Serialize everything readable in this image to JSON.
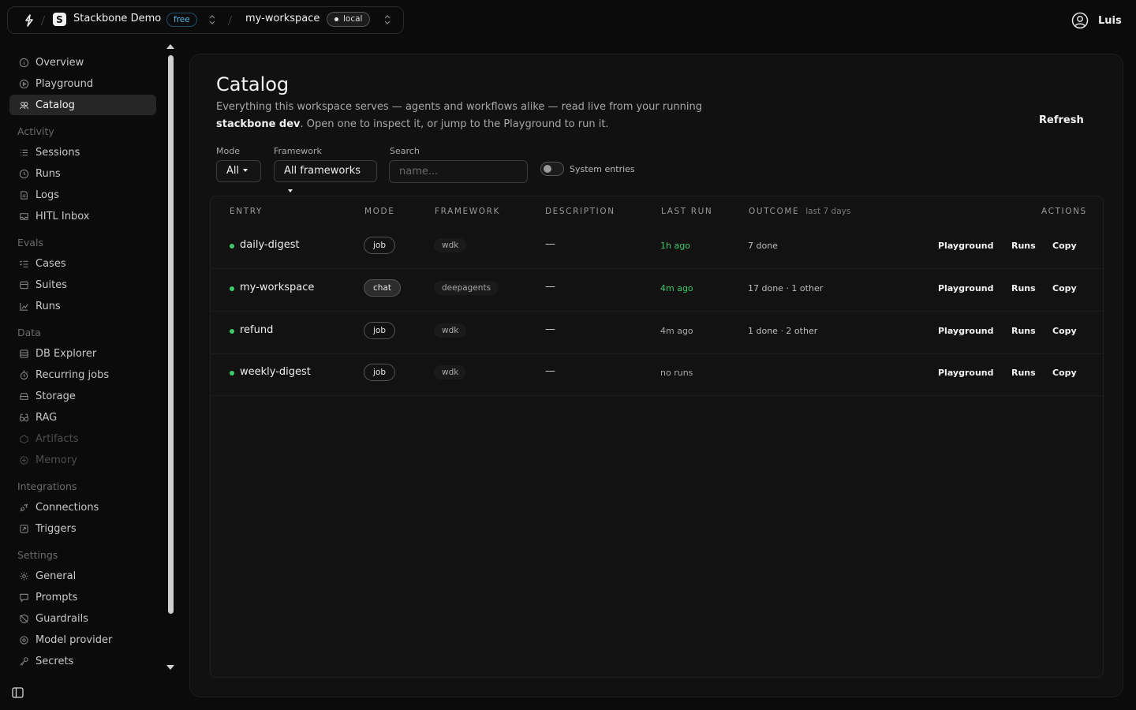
{
  "topbar": {
    "org_initial": "S",
    "org_name": "Stackbone Demo",
    "plan": "free",
    "workspace": "my-workspace",
    "env": "local"
  },
  "user": {
    "name": "Luis"
  },
  "sidebar": {
    "top_items": [
      {
        "label": "Overview",
        "icon": "info-circle-icon"
      },
      {
        "label": "Playground",
        "icon": "play-circle-icon"
      },
      {
        "label": "Catalog",
        "icon": "catalog-icon",
        "active": true
      }
    ],
    "groups": [
      {
        "label": "Activity",
        "items": [
          {
            "label": "Sessions",
            "icon": "list-icon"
          },
          {
            "label": "Runs",
            "icon": "clock-icon"
          },
          {
            "label": "Logs",
            "icon": "log-icon"
          },
          {
            "label": "HITL Inbox",
            "icon": "inbox-icon"
          }
        ]
      },
      {
        "label": "Evals",
        "items": [
          {
            "label": "Cases",
            "icon": "checklist-icon"
          },
          {
            "label": "Suites",
            "icon": "stack-icon"
          },
          {
            "label": "Runs",
            "icon": "chart-icon"
          }
        ]
      },
      {
        "label": "Data",
        "items": [
          {
            "label": "DB Explorer",
            "icon": "database-icon"
          },
          {
            "label": "Recurring jobs",
            "icon": "timer-icon"
          },
          {
            "label": "Storage",
            "icon": "storage-icon"
          },
          {
            "label": "RAG",
            "icon": "rag-icon"
          },
          {
            "label": "Artifacts",
            "icon": "artifact-icon",
            "disabled": true
          },
          {
            "label": "Memory",
            "icon": "memory-icon",
            "disabled": true
          }
        ]
      },
      {
        "label": "Integrations",
        "items": [
          {
            "label": "Connections",
            "icon": "plug-icon"
          },
          {
            "label": "Triggers",
            "icon": "trigger-icon"
          }
        ]
      },
      {
        "label": "Settings",
        "items": [
          {
            "label": "General",
            "icon": "gear-icon"
          },
          {
            "label": "Prompts",
            "icon": "message-icon"
          },
          {
            "label": "Guardrails",
            "icon": "shield-off-icon"
          },
          {
            "label": "Model provider",
            "icon": "model-icon"
          },
          {
            "label": "Secrets",
            "icon": "key-icon"
          }
        ]
      }
    ]
  },
  "page": {
    "title": "Catalog",
    "desc_part1": "Everything this workspace serves — agents and workflows alike — read live from your running ",
    "desc_bold": "stackbone dev",
    "desc_part2": ". Open one to inspect it, or jump to the Playground to run it.",
    "refresh_label": "Refresh"
  },
  "filters": {
    "mode_label": "Mode",
    "mode_value": "All",
    "framework_label": "Framework",
    "framework_value": "All frameworks",
    "search_label": "Search",
    "search_placeholder": "name...",
    "system_entries_label": "System entries",
    "system_entries_on": false
  },
  "table": {
    "headers": {
      "entry": "ENTRY",
      "mode": "MODE",
      "framework": "FRAMEWORK",
      "description": "DESCRIPTION",
      "last_run": "LAST RUN",
      "outcome": "OUTCOME",
      "outcome_sub": "last 7 days",
      "actions": "ACTIONS"
    },
    "action_labels": {
      "playground": "Playground",
      "runs": "Runs",
      "copy": "Copy"
    },
    "rows": [
      {
        "name": "daily-digest",
        "mode": "job",
        "framework": "wdk",
        "description": "—",
        "last_run": "1h ago",
        "last_run_recent": true,
        "outcome": "7 done"
      },
      {
        "name": "my-workspace",
        "mode": "chat",
        "framework": "deepagents",
        "description": "—",
        "last_run": "4m ago",
        "last_run_recent": true,
        "outcome": "17 done · 1 other"
      },
      {
        "name": "refund",
        "mode": "job",
        "framework": "wdk",
        "description": "—",
        "last_run": "4m ago",
        "last_run_recent": false,
        "outcome": "1 done · 2 other"
      },
      {
        "name": "weekly-digest",
        "mode": "job",
        "framework": "wdk",
        "description": "—",
        "last_run": "no runs",
        "last_run_recent": false,
        "outcome": ""
      }
    ]
  },
  "colors": {
    "accent_green": "#3ec96b",
    "plan_blue": "#52b6e8",
    "background": "#0b0b0b",
    "panel": "#111111"
  }
}
